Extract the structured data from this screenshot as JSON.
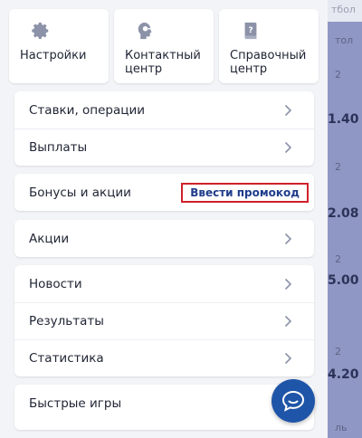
{
  "background": {
    "tab_text": "тбол",
    "header_text": "тол",
    "rows": [
      {
        "small": "2",
        "odds": "1.40"
      },
      {
        "small": "2",
        "odds": "2.08"
      },
      {
        "small": "2",
        "odds": "5.00"
      },
      {
        "small": "2",
        "odds": "4.20"
      }
    ],
    "footer_text": "ль"
  },
  "tiles": [
    {
      "label": "Настройки",
      "icon": "gear-icon"
    },
    {
      "label": "Контактный центр",
      "icon": "support-head-icon"
    },
    {
      "label": "Справочный центр",
      "icon": "help-book-icon"
    }
  ],
  "menu": {
    "group1": [
      "Ставки, операции",
      "Выплаты"
    ],
    "bonuses_label": "Бонусы и акции",
    "promo_button": "Ввести промокод",
    "group3": [
      "Акции"
    ],
    "group4": [
      "Новости",
      "Результаты",
      "Статистика"
    ],
    "group5": [
      "Быстрые игры"
    ]
  },
  "colors": {
    "accent": "#1f55a8",
    "promo_border": "#d0202a",
    "promo_text": "#1f3c8c"
  },
  "fab": {
    "icon": "chat-bubble-icon"
  }
}
